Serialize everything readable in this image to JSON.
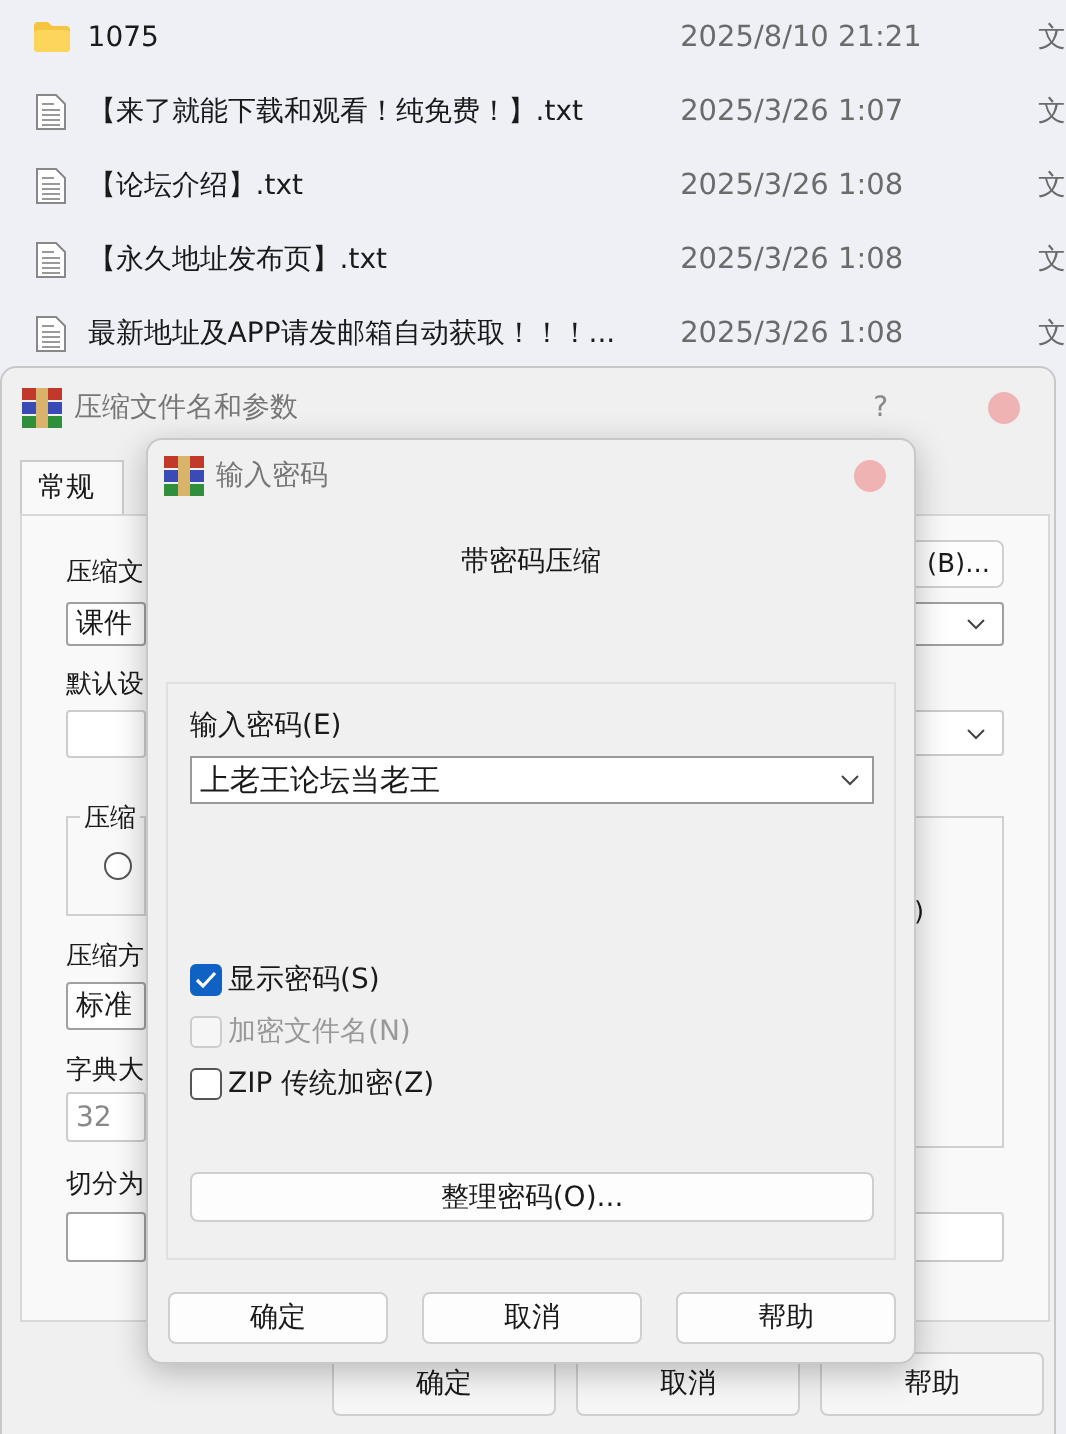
{
  "file_list": [
    {
      "kind": "folder",
      "name": "1075",
      "date": "2025/8/10 21:21",
      "column_3": "文"
    },
    {
      "kind": "text-file",
      "name": "【来了就能下载和观看！纯免费！】.txt",
      "date": "2025/3/26 1:07",
      "column_3": "文"
    },
    {
      "kind": "text-file",
      "name": "【论坛介绍】.txt",
      "date": "2025/3/26 1:08",
      "column_3": "文"
    },
    {
      "kind": "text-file",
      "name": "【永久地址发布页】.txt",
      "date": "2025/3/26 1:08",
      "column_3": "文"
    },
    {
      "kind": "text-file",
      "name": "最新地址及APP请发邮箱自动获取！！！...",
      "date": "2025/3/26 1:08",
      "column_3": "文"
    }
  ],
  "back_dialog": {
    "title": "压缩文件名和参数",
    "help": "?",
    "tabs": [
      {
        "label": "常规",
        "selected": true
      }
    ],
    "left": {
      "archive_label": "压缩文",
      "archive_value": "课件",
      "profile_label": "默认设",
      "format_group": "压缩",
      "format_radio_checked": false,
      "method_label": "压缩方",
      "method_value": "标准",
      "dict_label": "字典大",
      "dict_value": "32",
      "split_label": "切分为"
    },
    "right": {
      "browse_button": "(B)...",
      "option_fragment": ")"
    },
    "buttons": [
      "确定",
      "取消",
      "帮助"
    ]
  },
  "password_dialog": {
    "title": "输入密码",
    "heading": "带密码压缩",
    "password_label": "输入密码(E)",
    "password_value": "上老王论坛当老王",
    "options": [
      {
        "label": "显示密码(S)",
        "checked": true,
        "disabled": false
      },
      {
        "label": "加密文件名(N)",
        "checked": false,
        "disabled": true
      },
      {
        "label": "ZIP 传统加密(Z)",
        "checked": false,
        "disabled": false
      }
    ],
    "organize_button": "整理密码(O)...",
    "buttons": [
      "确定",
      "取消",
      "帮助"
    ]
  }
}
